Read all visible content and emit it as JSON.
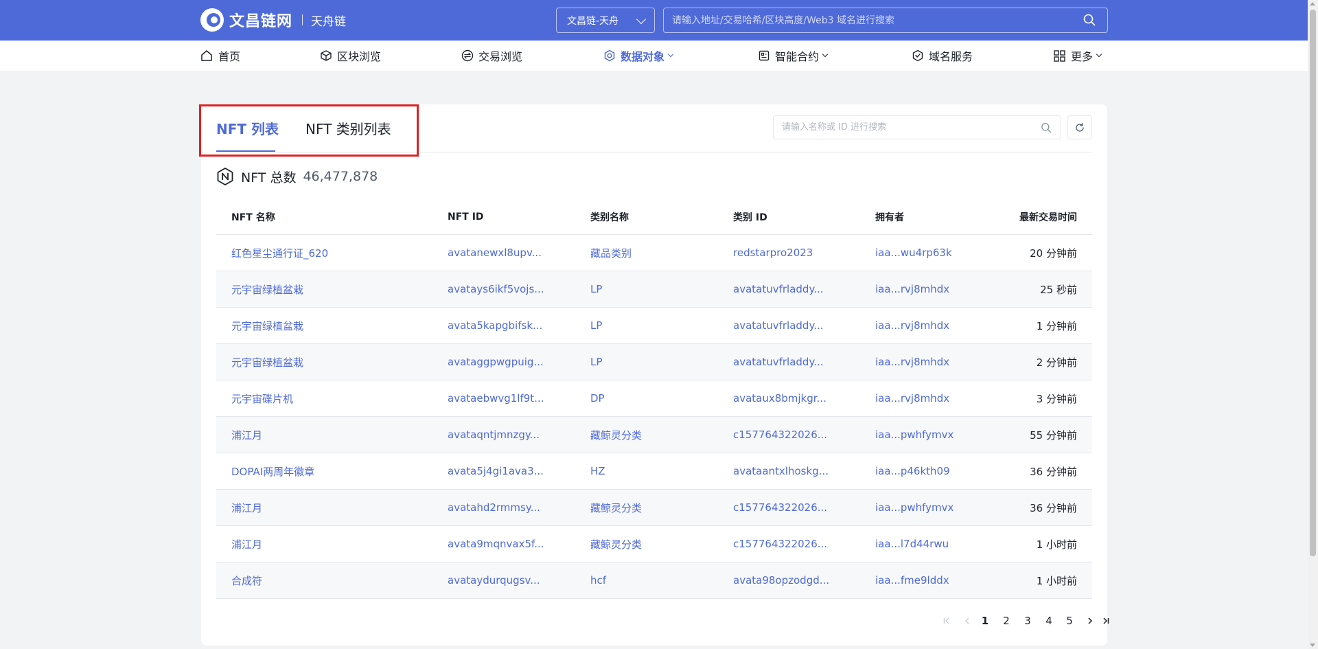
{
  "header": {
    "logo_text": "文昌链网",
    "logo_sub": "天舟链",
    "chain_select": "文昌链-天舟",
    "search_placeholder": "请输入地址/交易哈希/区块高度/Web3 域名进行搜索"
  },
  "nav": {
    "items": [
      {
        "label": "首页",
        "icon": "home-icon"
      },
      {
        "label": "区块浏览",
        "icon": "cube-icon"
      },
      {
        "label": "交易浏览",
        "icon": "exchange-icon"
      },
      {
        "label": "数据对象",
        "icon": "data-object-icon",
        "active": true
      },
      {
        "label": "智能合约",
        "icon": "contract-icon"
      },
      {
        "label": "域名服务",
        "icon": "domain-icon"
      },
      {
        "label": "更多",
        "icon": "grid-icon"
      }
    ]
  },
  "tabs": [
    "NFT 列表",
    "NFT 类别列表"
  ],
  "nft_search_placeholder": "请输入名称或 ID 进行搜索",
  "total": {
    "label": "NFT 总数",
    "value": "46,477,878"
  },
  "table": {
    "columns": [
      "NFT 名称",
      "NFT ID",
      "类别名称",
      "类别 ID",
      "拥有者",
      "最新交易时间"
    ],
    "rows": [
      [
        "红色星尘通行证_620",
        "avatanewxl8upv...",
        "藏品类别",
        "redstarpro2023",
        "iaa...wu4rp63k",
        "20 分钟前"
      ],
      [
        "元宇宙绿植盆栽",
        "avatays6ikf5vojs...",
        "LP",
        "avatatuvfrladdy...",
        "iaa...rvj8mhdx",
        "25 秒前"
      ],
      [
        "元宇宙绿植盆栽",
        "avata5kapgbifsk...",
        "LP",
        "avatatuvfrladdy...",
        "iaa...rvj8mhdx",
        "1 分钟前"
      ],
      [
        "元宇宙绿植盆栽",
        "avataggpwgpuig...",
        "LP",
        "avatatuvfrladdy...",
        "iaa...rvj8mhdx",
        "2 分钟前"
      ],
      [
        "元宇宙碟片机",
        "avataebwvg1lf9t...",
        "DP",
        "avataux8bmjkgr...",
        "iaa...rvj8mhdx",
        "3 分钟前"
      ],
      [
        "浦江月",
        "avataqntjmnzgy...",
        "藏鲸灵分类",
        "c157764322026...",
        "iaa...pwhfymvx",
        "55 分钟前"
      ],
      [
        "DOPAI两周年徽章",
        "avata5j4gi1ava3...",
        "HZ",
        "avataantxlhoskg...",
        "iaa...p46kth09",
        "36 分钟前"
      ],
      [
        "浦江月",
        "avatahd2rmmsy...",
        "藏鲸灵分类",
        "c157764322026...",
        "iaa...pwhfymvx",
        "36 分钟前"
      ],
      [
        "浦江月",
        "avata9mqnvax5f...",
        "藏鲸灵分类",
        "c157764322026...",
        "iaa...l7d44rwu",
        "1 小时前"
      ],
      [
        "合成符",
        "avataydurqugsv...",
        "hcf",
        "avata98opzodgd...",
        "iaa...fme9lddx",
        "1 小时前"
      ]
    ]
  },
  "pagination": {
    "pages": [
      "1",
      "2",
      "3",
      "4",
      "5"
    ],
    "current": "1"
  },
  "colors": {
    "primary": "#4e6ad9",
    "highlight": "#e02020"
  }
}
